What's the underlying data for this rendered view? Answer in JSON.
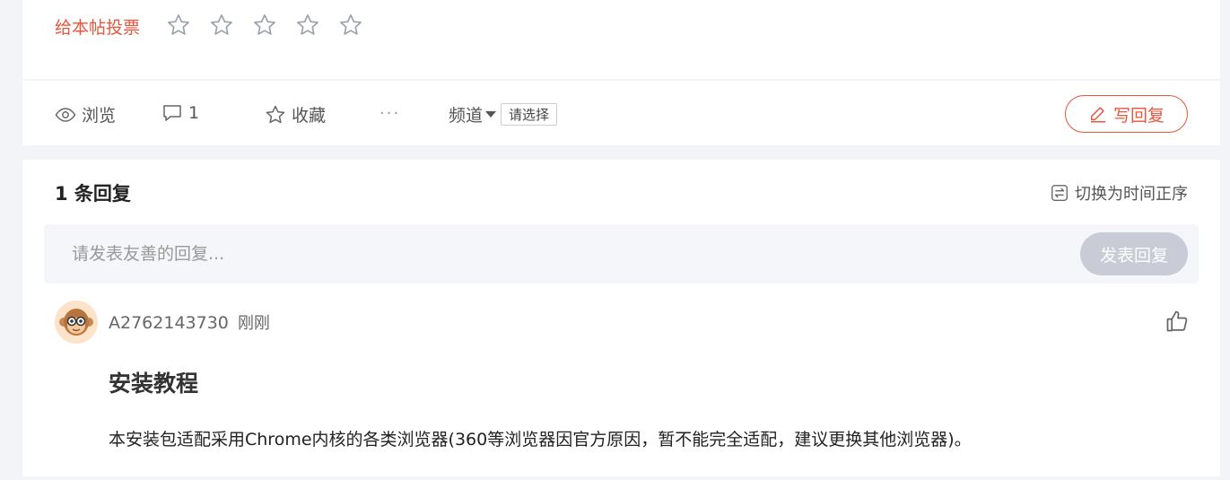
{
  "vote": {
    "label": "给本帖投票",
    "star_count": 5,
    "rating": 0,
    "star_color": "#9aa0ab"
  },
  "actions": {
    "view_label": "浏览",
    "comment_count": "1",
    "favorite_label": "收藏",
    "more_label": "···",
    "channel_label": "频道",
    "channel_select": "请选择",
    "write_reply_label": "写回复"
  },
  "replies": {
    "count_label": "1 条回复",
    "sort_toggle_label": "切换为时间正序",
    "input_placeholder": "请发表友善的回复...",
    "submit_label": "发表回复",
    "items": [
      {
        "author": "A2762143730",
        "time": "刚刚",
        "title": "安装教程",
        "text": "本安装包适配采用Chrome内核的各类浏览器(360等浏览器因官方原因，暂不能完全适配，建议更换其他浏览器)。"
      }
    ]
  },
  "colors": {
    "accent": "#e8563d",
    "page_bg": "#f2f4f7",
    "submit_disabled": "#c9ccd6"
  }
}
